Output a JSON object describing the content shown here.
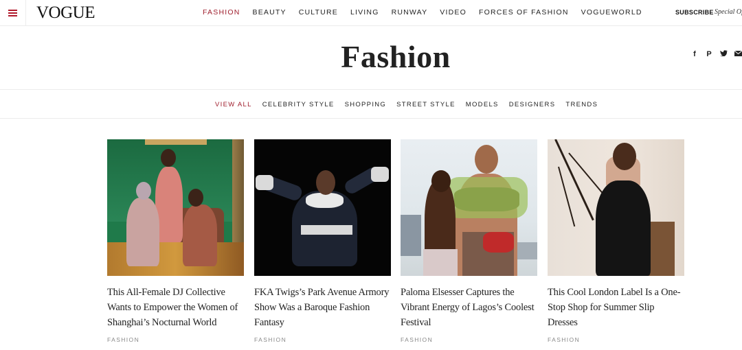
{
  "header": {
    "logo": "VOGUE",
    "nav": [
      "FASHION",
      "BEAUTY",
      "CULTURE",
      "LIVING",
      "RUNWAY",
      "VIDEO",
      "FORCES OF FASHION",
      "VOGUEWORLD"
    ],
    "active_nav": "FASHION",
    "subscribe": "SUBSCRIBE",
    "special": "Special Of"
  },
  "page": {
    "title": "Fashion",
    "social_icons": [
      "facebook-icon",
      "pinterest-icon",
      "twitter-icon",
      "mail-icon"
    ]
  },
  "subnav": {
    "items": [
      "VIEW ALL",
      "CELEBRITY STYLE",
      "SHOPPING",
      "STREET STYLE",
      "MODELS",
      "DESIGNERS",
      "TRENDS"
    ],
    "active": "VIEW ALL"
  },
  "cards": [
    {
      "headline": "This All-Female DJ Collective Wants to Empower the Women of Shanghai’s Nocturnal World",
      "tag": "FASHION"
    },
    {
      "headline": "FKA Twigs’s Park Avenue Armory Show Was a Baroque Fashion Fantasy",
      "tag": "FASHION"
    },
    {
      "headline": "Paloma Elsesser Captures the Vibrant Energy of Lagos’s Coolest Festival",
      "tag": "FASHION"
    },
    {
      "headline": "This Cool London Label Is a One-Stop Shop for Summer Slip Dresses",
      "tag": "FASHION"
    }
  ],
  "colors": {
    "accent": "#9f1d2c",
    "text": "#222222",
    "tag": "#888888"
  }
}
